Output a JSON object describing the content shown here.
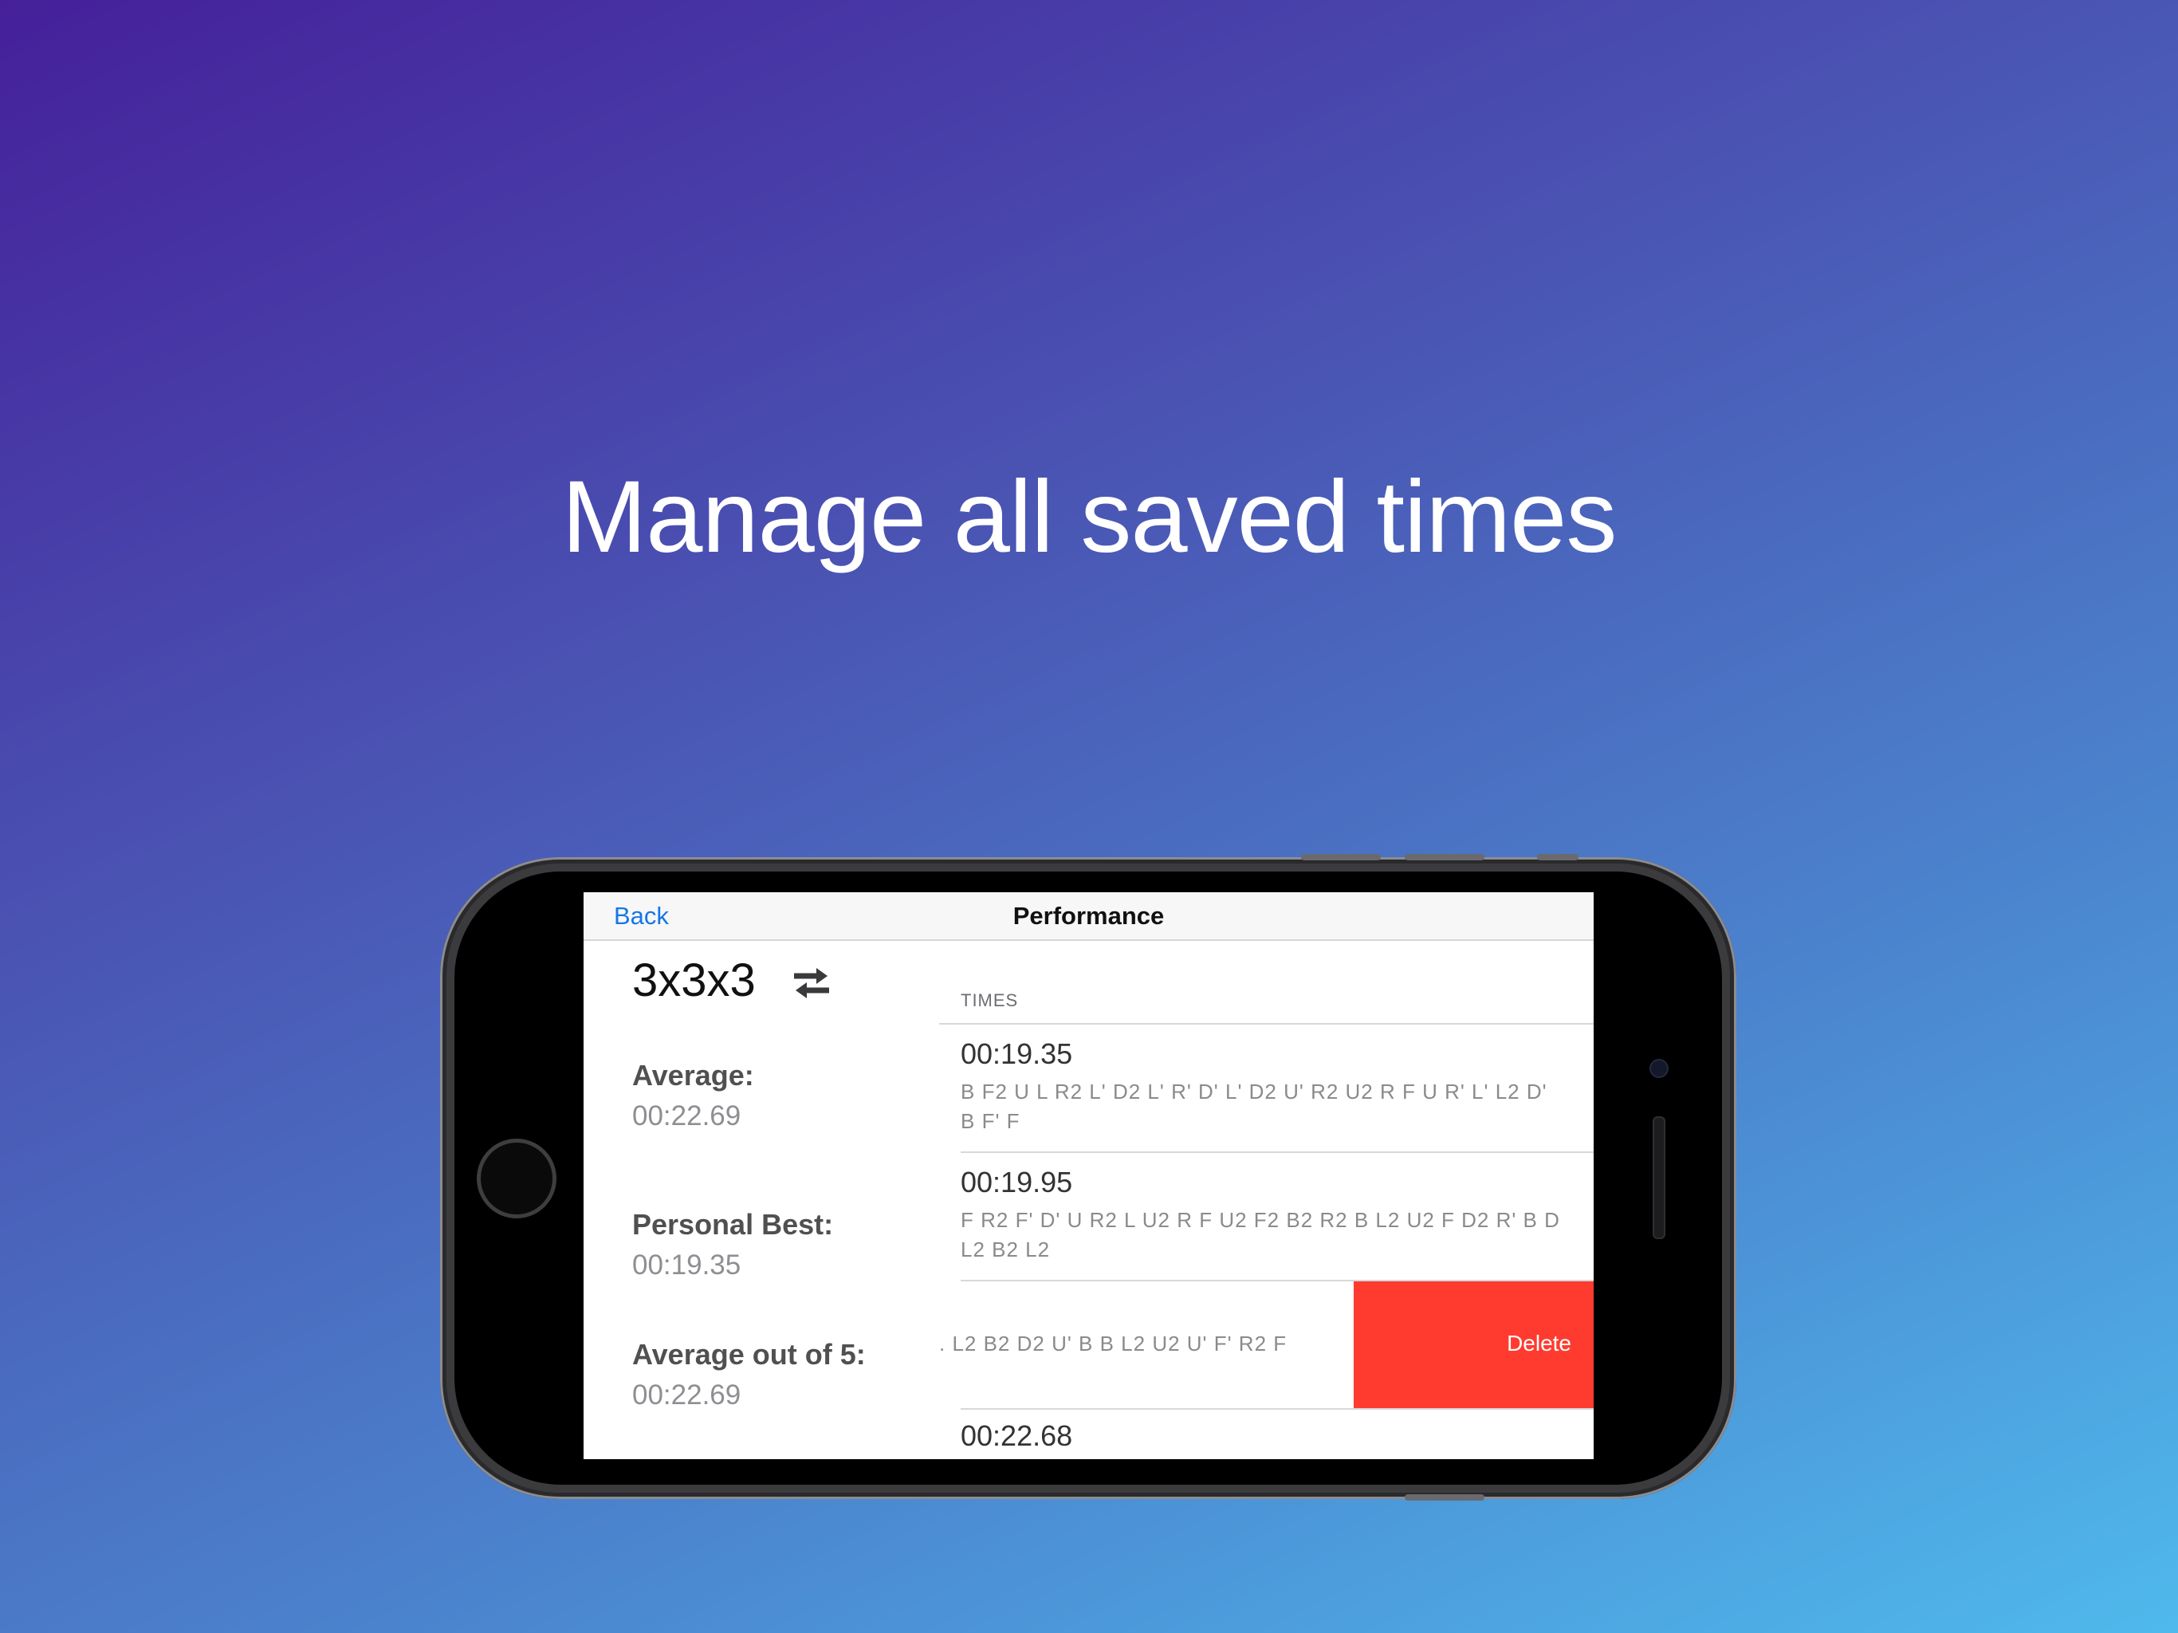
{
  "headline": "Manage all saved times",
  "navbar": {
    "back_label": "Back",
    "title": "Performance"
  },
  "left_panel": {
    "puzzle": "3x3x3",
    "switch_icon": "swap-arrows-icon",
    "stats": [
      {
        "label": "Average:",
        "value": "00:22.69"
      },
      {
        "label": "Personal Best:",
        "value": "00:19.35"
      },
      {
        "label": "Average out of 5:",
        "value": "00:22.69"
      }
    ]
  },
  "times": {
    "header": "TIMES",
    "rows": [
      {
        "time": "00:19.35",
        "scramble": "B F2 U L R2 L' D2 L' R' D' L' D2 U' R2 U2 R F U R' L' L2 D' B F' F"
      },
      {
        "time": "00:19.95",
        "scramble": "F R2 F' D' U R2 L U2 R F U2 F2 B2 R2 B L2 U2 F D2 R' B D L2 B2 L2"
      },
      {
        "time": "",
        "scramble": ". L2 B2 D2 U' B B L2 U2 U' F' R2 F"
      },
      {
        "time": "00:22.68",
        "scramble": ""
      }
    ],
    "delete_label": "Delete"
  },
  "colors": {
    "accent": "#1677e5",
    "delete": "#ff3b30"
  }
}
